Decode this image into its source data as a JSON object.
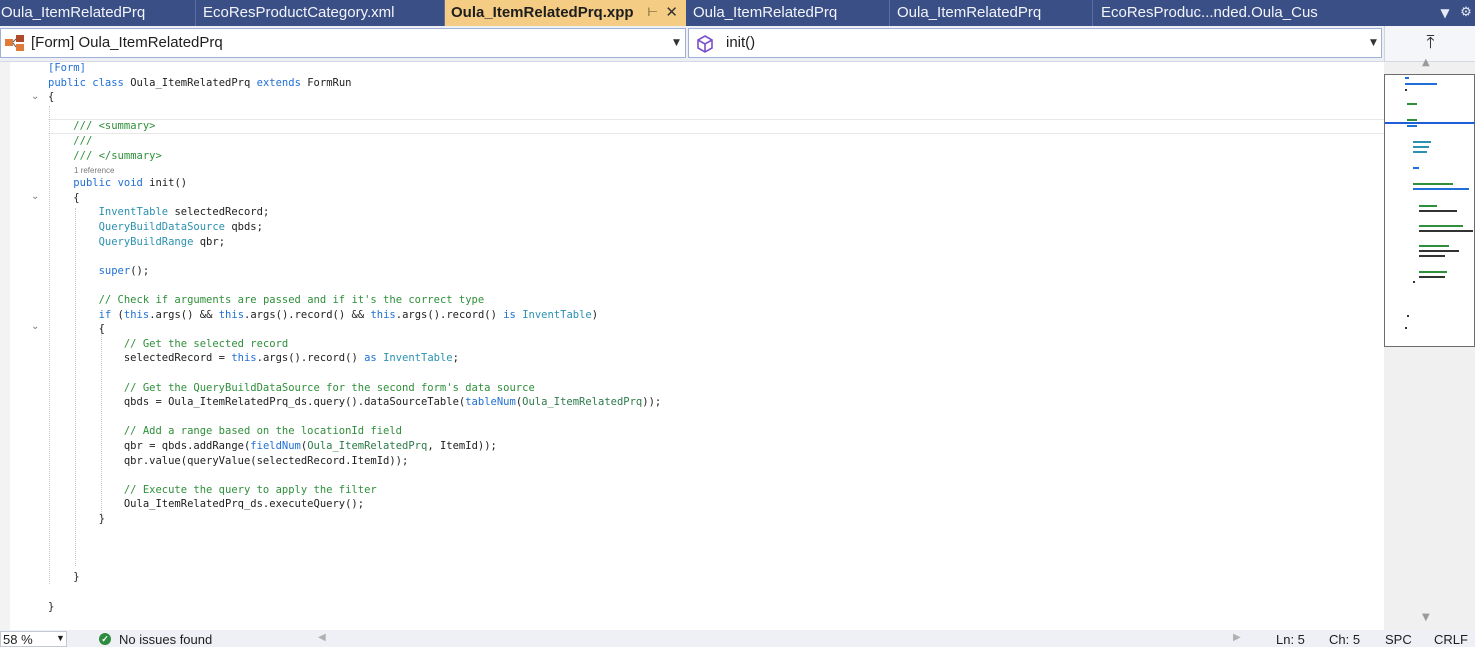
{
  "tabs": [
    {
      "label": "Oula_ItemRelatedPrq",
      "active": false
    },
    {
      "label": "EcoResProductCategory.xml",
      "active": false
    },
    {
      "label": "Oula_ItemRelatedPrq.xpp",
      "active": true,
      "pin_icon": "pin-icon",
      "close_icon": "close-icon"
    },
    {
      "label": "Oula_ItemRelatedPrq",
      "active": false
    },
    {
      "label": "Oula_ItemRelatedPrq",
      "active": false
    },
    {
      "label": "EcoResProduc...nded.Oula_Cus",
      "active": false
    }
  ],
  "tab_controls": {
    "dropdown_icon": "tab-list-dropdown-icon",
    "settings_icon": "gear-icon"
  },
  "nav": {
    "type_selector": "[Form] Oula_ItemRelatedPrq",
    "member_selector": "init()",
    "type_icon": "form-object-icon",
    "member_icon": "method-cube-icon",
    "split_icon": "split-window-icon"
  },
  "code": {
    "lens_reference": "1 reference",
    "lines": [
      "[Form]",
      "public class Oula_ItemRelatedPrq extends FormRun",
      "{",
      "",
      "    /// <summary>",
      "    ///",
      "    /// </summary>",
      "    public void init()",
      "    {",
      "        InventTable selectedRecord;",
      "        QueryBuildDataSource qbds;",
      "        QueryBuildRange qbr;",
      "",
      "        super();",
      "",
      "        // Check if arguments are passed and if it's the correct type",
      "        if (this.args() && this.args().record() && this.args().record() is InventTable)",
      "        {",
      "            // Get the selected record",
      "            selectedRecord = this.args().record() as InventTable;",
      "",
      "            // Get the QueryBuildDataSource for the second form's data source",
      "            qbds = Oula_ItemRelatedPrq_ds.query().dataSourceTable(tableNum(Oula_ItemRelatedPrq));",
      "",
      "            // Add a range based on the locationId field",
      "            qbr = qbds.addRange(fieldNum(Oula_ItemRelatedPrq, ItemId));",
      "            qbr.value(queryValue(selectedRecord.ItemId));",
      "",
      "            // Execute the query to apply the filter",
      "            Oula_ItemRelatedPrq_ds.executeQuery();",
      "        }",
      "",
      "",
      "",
      "    }",
      "",
      "}"
    ]
  },
  "status": {
    "zoom": "58 %",
    "issues": "No issues found",
    "issues_icon": "check-circle-icon",
    "line": "Ln: 5",
    "char": "Ch: 5",
    "spacing": "SPC",
    "line_ending": "CRLF"
  },
  "colors": {
    "tabbar_bg": "#3a4f85",
    "active_tab_bg": "#f5cc84",
    "keyword": "#1f6fd6",
    "type": "#2b91af",
    "comment": "#2f8f3a"
  }
}
